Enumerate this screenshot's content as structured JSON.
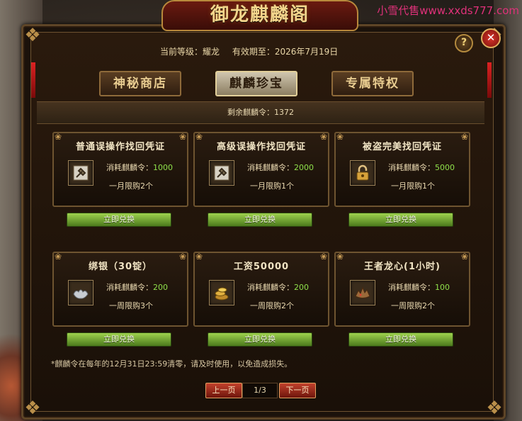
{
  "watermark": "小雪代售www.xxds777.com",
  "window": {
    "title": "御龙麒麟阁",
    "help_label": "?",
    "close_label": "✕"
  },
  "info": {
    "level": "当前等级：耀龙",
    "expiry": "有效期至：2026年7月19日"
  },
  "tabs": [
    {
      "label": "神秘商店",
      "active": false
    },
    {
      "label": "麒麟珍宝",
      "active": true
    },
    {
      "label": "专属特权",
      "active": false
    }
  ],
  "remaining": "剩余麒麟令：1372",
  "cost_label": "消耗麒麟令：",
  "redeem_label": "立即兑换",
  "items": [
    {
      "title": "普通误操作找回凭证",
      "icon": "hammer-icon",
      "cost": "1000",
      "limit": "一月限购2个"
    },
    {
      "title": "高级误操作找回凭证",
      "icon": "hammer-icon",
      "cost": "2000",
      "limit": "一月限购1个"
    },
    {
      "title": "被盗完美找回凭证",
      "icon": "lock-icon",
      "cost": "5000",
      "limit": "一月限购1个"
    },
    {
      "title": "绑银（30锭）",
      "icon": "silver-ingot-icon",
      "cost": "200",
      "limit": "一周限购3个"
    },
    {
      "title": "工资50000",
      "icon": "gold-coins-icon",
      "cost": "200",
      "limit": "一周限购2个"
    },
    {
      "title": "王者龙心(1小时)",
      "icon": "dragon-icon",
      "cost": "100",
      "limit": "一周限购2个"
    }
  ],
  "note": "*麒麟令在每年的12月31日23:59清零，请及时使用，以免造成损失。",
  "pager": {
    "prev_label": "上一页",
    "page": "1/3",
    "next_label": "下一页"
  },
  "colors": {
    "accent_gold": "#f3d58c",
    "cost_green": "#8fe04a",
    "button_green": "#9ed24e",
    "pager_red": "#c2412c",
    "watermark_pink": "#e0317a"
  }
}
